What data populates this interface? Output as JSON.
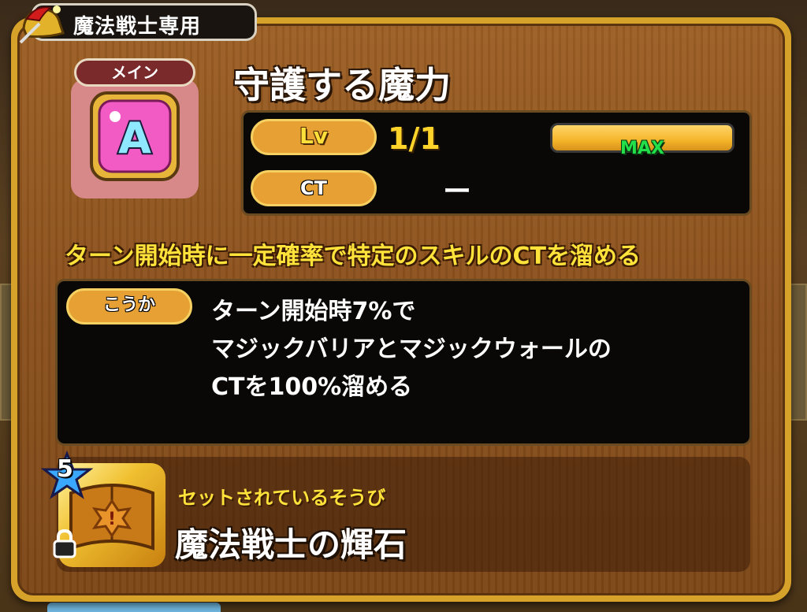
{
  "class_tag": {
    "label": "魔法戦士専用"
  },
  "skill": {
    "badge": "メイン",
    "icon_letter": "A",
    "name": "守護する魔力"
  },
  "stats": {
    "lv_label": "Lv",
    "lv_value": "1/1",
    "ct_label": "CT",
    "ct_value": "ー",
    "max_label": "MAX"
  },
  "summary": "ターン開始時に一定確率で特定のスキルのCTを溜める",
  "effect": {
    "label": "こうか",
    "lines": [
      "ターン開始時7%で",
      "マジックバリアとマジックウォールの",
      "CTを100%溜める"
    ]
  },
  "equipment": {
    "stars": "5",
    "subtitle": "セットされているそうび",
    "name": "魔法戦士の輝石",
    "icon": "spellbook-icon",
    "locked_icon": "lock-icon"
  },
  "colors": {
    "panel_gold": "#d7a22a",
    "wood": "#8a501c",
    "accent_yellow": "#ffe23a",
    "max_green": "#23e04a",
    "pill_orange": "#e7a033"
  }
}
